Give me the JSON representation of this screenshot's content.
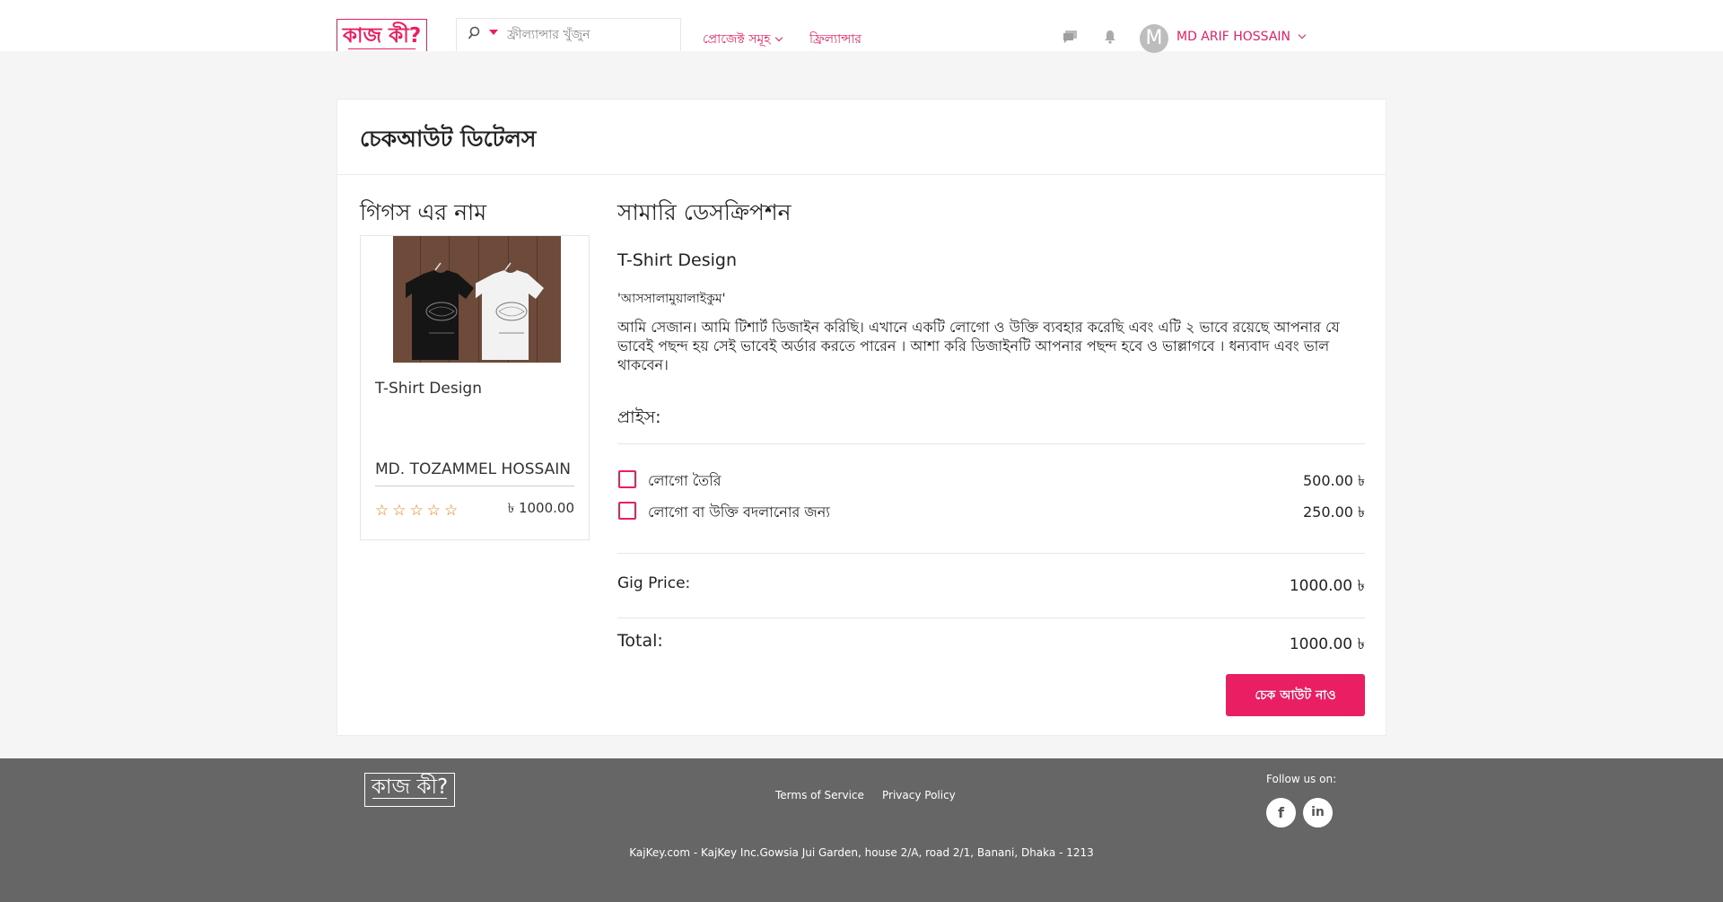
{
  "header": {
    "logo_text": "কাজ কী?",
    "search_placeholder": "ফ্রীল্যান্সার খুঁজুন",
    "nav": [
      {
        "label": "প্রোজেক্ট সমূহ"
      },
      {
        "label": "ফ্রিল্যান্সার"
      }
    ],
    "avatar_letter": "M",
    "username": "MD ARIF HOSSAIN",
    "icons": [
      "message-icon",
      "bell-icon",
      "search-icon",
      "chevron-down-icon"
    ]
  },
  "checkout": {
    "title": "চেকআউট ডিটেলস",
    "gig_section_title": "গিগস এর নাম",
    "gig": {
      "title": "T-Shirt Design",
      "seller": "MD. TOZAMMEL HOSSAIN",
      "rating": 0,
      "stars": "☆☆☆☆☆",
      "price": "৳ 1000.00"
    },
    "summary_title": "সামারি ডেসক্রিপশন",
    "summary_name": "T-Shirt Design",
    "greeting": "'আসসালামুয়ালাইকুম'",
    "description": "আমি সেজান। আমি টি‌শার্ট ডিজাইন করিছি। এখানে একটি লোগো ও উক্তি ব্যবহার করেছি এবং এটি ২ ভাবে রয়েছে আপনার যে ভাবেই পছন্দ হয় সেই ভাবেই অর্ডার করতে পারেন । আশা করি ডিজাইনটি আপনার পছন্দ হবে ও ভাল্লাগবে । ধন্যবাদ এবং ভাল থাকবেন।",
    "price_label": "প্রাইস:",
    "options": [
      {
        "label": "লোগো তৈরি",
        "amount": "500.00 ৳",
        "checked": false
      },
      {
        "label": "লোগো বা উক্তি বদলানোর জন্য",
        "amount": "250.00 ৳",
        "checked": false
      }
    ],
    "gig_price_label": "Gig Price:",
    "gig_price_value": "1000.00 ৳",
    "total_label": "Total:",
    "total_value": "1000.00 ৳",
    "checkout_button": "চেক আউট নাও"
  },
  "footer": {
    "logo_text": "কাজ কী?",
    "links": [
      "Terms of Service",
      "Privacy Policy"
    ],
    "follow_label": "Follow us on:",
    "social": [
      {
        "name": "facebook",
        "glyph": "f"
      },
      {
        "name": "linkedin",
        "glyph": "in"
      }
    ],
    "address": "KajKey.com - KajKey Inc.Gowsia Jui Garden, house 2/A, road 2/1, Banani, Dhaka - 1213"
  },
  "colors": {
    "accent": "#e91e63",
    "star": "#e67e00",
    "footer_bg": "#666666"
  }
}
